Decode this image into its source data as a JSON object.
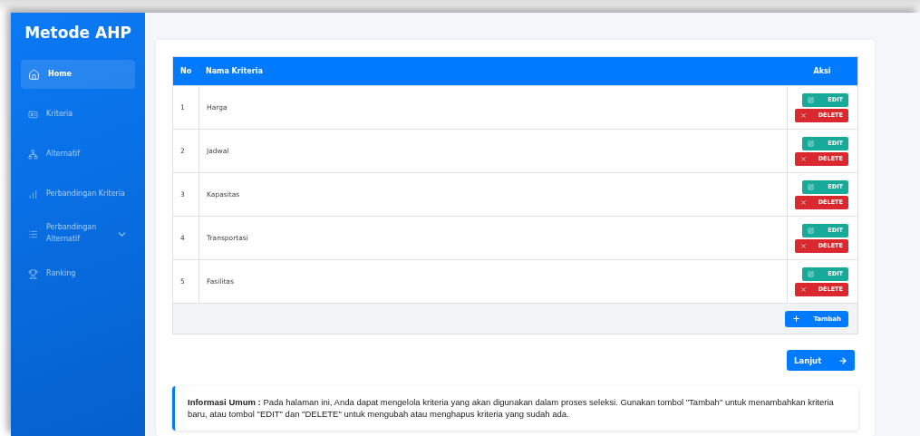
{
  "sidebar": {
    "title": "Metode AHP",
    "items": [
      {
        "label": "Home",
        "selected": true,
        "expandable": false
      },
      {
        "label": "Kriteria",
        "selected": false,
        "expandable": false
      },
      {
        "label": "Alternatif",
        "selected": false,
        "expandable": false
      },
      {
        "label": "Perbandingan Kriteria",
        "selected": false,
        "expandable": false
      },
      {
        "label": "Perbandingan Alternatif",
        "selected": false,
        "expandable": true
      },
      {
        "label": "Ranking",
        "selected": false,
        "expandable": false
      }
    ]
  },
  "table": {
    "columns": [
      "No",
      "Nama Kriteria",
      "Aksi"
    ],
    "rows": [
      {
        "no": "1",
        "name": "Harga",
        "actions": [
          "EDIT",
          "DELETE"
        ]
      },
      {
        "no": "2",
        "name": "Jadwal",
        "actions": [
          "EDIT",
          "DELETE"
        ]
      },
      {
        "no": "3",
        "name": "Kapasitas",
        "actions": [
          "EDIT",
          "DELETE"
        ]
      },
      {
        "no": "4",
        "name": "Transportasi",
        "actions": [
          "EDIT",
          "DELETE"
        ]
      },
      {
        "no": "5",
        "name": "Fasilitas",
        "actions": [
          "EDIT",
          "DELETE"
        ]
      }
    ],
    "add_button": "Tambah"
  },
  "next_button": "Lanjut",
  "info": "**Informasi Umum :** Pada halaman ini, Anda dapat mengelola kriteria yang akan digunakan dalam proses seleksi. Gunakan tombol \"Tambah\" untuk menambahkan kriteria baru, atau tombol \"EDIT\" dan \"DELETE\" untuk mengubah atau menghapus kriteria yang sudah ada."
}
